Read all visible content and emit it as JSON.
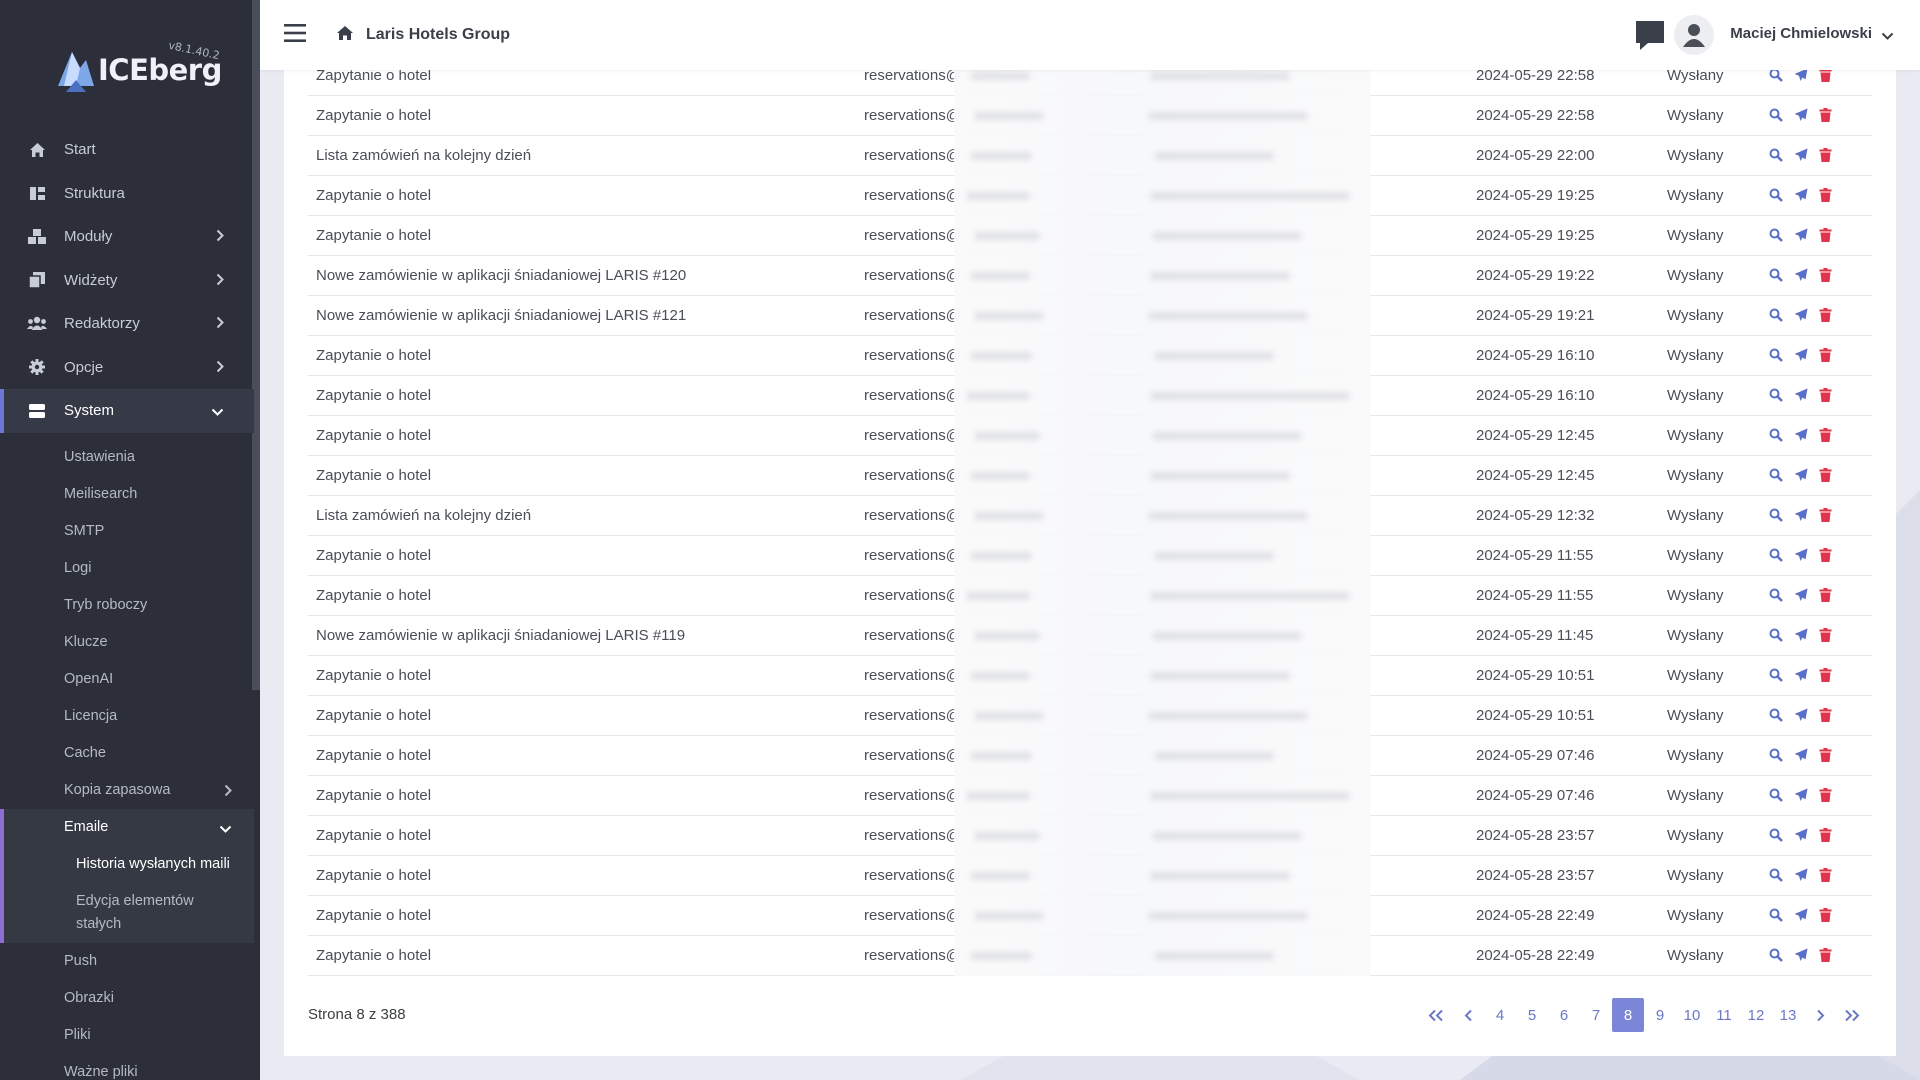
{
  "app": {
    "logo_text": "ICEberg",
    "version": "v8.1.40.2",
    "brand": "Laris Hotels Group"
  },
  "user": {
    "name": "Maciej Chmielowski"
  },
  "sidebar": {
    "items": [
      {
        "label": "Start",
        "icon": "home-icon",
        "chevron": false
      },
      {
        "label": "Struktura",
        "icon": "structure-icon",
        "chevron": false
      },
      {
        "label": "Moduły",
        "icon": "cubes-icon",
        "chevron": true
      },
      {
        "label": "Widżety",
        "icon": "copy-icon",
        "chevron": true
      },
      {
        "label": "Redaktorzy",
        "icon": "users-icon",
        "chevron": true
      },
      {
        "label": "Opcje",
        "icon": "gear-icon",
        "chevron": true
      },
      {
        "label": "System",
        "icon": "server-icon",
        "chevron": "down"
      }
    ],
    "system_sub": [
      "Ustawienia",
      "Meilisearch",
      "SMTP",
      "Logi",
      "Tryb roboczy",
      "Klucze",
      "OpenAI",
      "Licencja",
      "Cache"
    ],
    "backup": "Kopia zapasowa",
    "emails": "Emaile",
    "email_sub": [
      "Historia wysłanych maili",
      "Edycja elementów stałych"
    ],
    "after": [
      "Push",
      "Obrazki",
      "Pliki",
      "Ważne pliki"
    ]
  },
  "table": {
    "sender_prefix": "reservations@",
    "rows": [
      {
        "subject": "Zapytanie o hotel",
        "date": "2024-05-29 22:58",
        "status": "Wysłany"
      },
      {
        "subject": "Zapytanie o hotel",
        "date": "2024-05-29 22:58",
        "status": "Wysłany"
      },
      {
        "subject": "Lista zamówień na kolejny dzień",
        "date": "2024-05-29 22:00",
        "status": "Wysłany"
      },
      {
        "subject": "Zapytanie o hotel",
        "date": "2024-05-29 19:25",
        "status": "Wysłany"
      },
      {
        "subject": "Zapytanie o hotel",
        "date": "2024-05-29 19:25",
        "status": "Wysłany"
      },
      {
        "subject": "Nowe zamówienie w aplikacji śniadaniowej LARIS #120",
        "date": "2024-05-29 19:22",
        "status": "Wysłany"
      },
      {
        "subject": "Nowe zamówienie w aplikacji śniadaniowej LARIS #121",
        "date": "2024-05-29 19:21",
        "status": "Wysłany"
      },
      {
        "subject": "Zapytanie o hotel",
        "date": "2024-05-29 16:10",
        "status": "Wysłany"
      },
      {
        "subject": "Zapytanie o hotel",
        "date": "2024-05-29 16:10",
        "status": "Wysłany"
      },
      {
        "subject": "Zapytanie o hotel",
        "date": "2024-05-29 12:45",
        "status": "Wysłany"
      },
      {
        "subject": "Zapytanie o hotel",
        "date": "2024-05-29 12:45",
        "status": "Wysłany"
      },
      {
        "subject": "Lista zamówień na kolejny dzień",
        "date": "2024-05-29 12:32",
        "status": "Wysłany"
      },
      {
        "subject": "Zapytanie o hotel",
        "date": "2024-05-29 11:55",
        "status": "Wysłany"
      },
      {
        "subject": "Zapytanie o hotel",
        "date": "2024-05-29 11:55",
        "status": "Wysłany"
      },
      {
        "subject": "Nowe zamówienie w aplikacji śniadaniowej LARIS #119",
        "date": "2024-05-29 11:45",
        "status": "Wysłany"
      },
      {
        "subject": "Zapytanie o hotel",
        "date": "2024-05-29 10:51",
        "status": "Wysłany"
      },
      {
        "subject": "Zapytanie o hotel",
        "date": "2024-05-29 10:51",
        "status": "Wysłany"
      },
      {
        "subject": "Zapytanie o hotel",
        "date": "2024-05-29 07:46",
        "status": "Wysłany"
      },
      {
        "subject": "Zapytanie o hotel",
        "date": "2024-05-29 07:46",
        "status": "Wysłany"
      },
      {
        "subject": "Zapytanie o hotel",
        "date": "2024-05-28 23:57",
        "status": "Wysłany"
      },
      {
        "subject": "Zapytanie o hotel",
        "date": "2024-05-28 23:57",
        "status": "Wysłany"
      },
      {
        "subject": "Zapytanie o hotel",
        "date": "2024-05-28 22:49",
        "status": "Wysłany"
      },
      {
        "subject": "Zapytanie o hotel",
        "date": "2024-05-28 22:49",
        "status": "Wysłany"
      }
    ],
    "action_icons": [
      "search-icon",
      "send-icon",
      "trash-icon"
    ]
  },
  "pagination": {
    "info": "Strona 8 z 388",
    "pages": [
      "4",
      "5",
      "6",
      "7",
      "8",
      "9",
      "10",
      "11",
      "12",
      "13"
    ],
    "current": "8"
  },
  "colors": {
    "sidebar_bg": "#2c2f3a",
    "accent": "#7b86d8",
    "action_blue": "#5a6fc7",
    "action_red": "#e0344a"
  }
}
